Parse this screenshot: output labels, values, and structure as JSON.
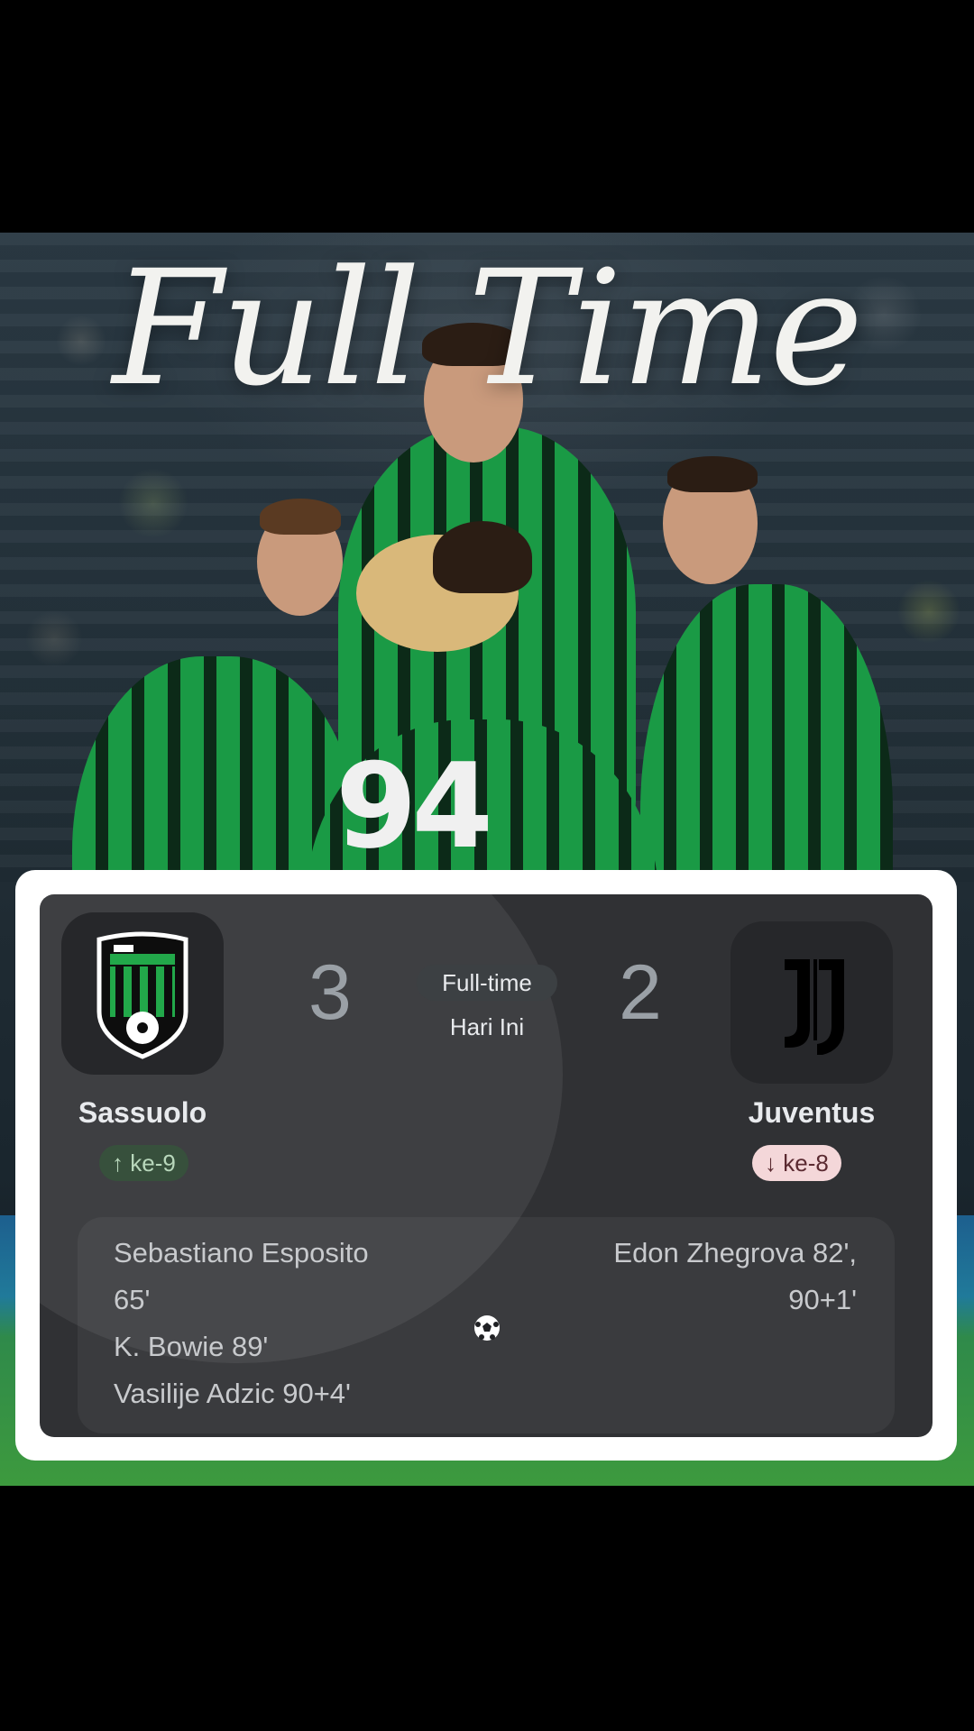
{
  "overlay_title": "Full Time",
  "jersey_number": "94",
  "match": {
    "status": "Full-time",
    "date_label": "Hari Ini",
    "home": {
      "name": "Sassuolo",
      "score": "3",
      "rank_label": "ke-9",
      "rank_arrow": "↑",
      "scorers": [
        "Sebastiano Esposito",
        "65'",
        "K. Bowie 89'",
        "Vasilije Adzic 90+4'"
      ]
    },
    "away": {
      "name": "Juventus",
      "score": "2",
      "rank_label": "ke-8",
      "rank_arrow": "↓",
      "scorers": [
        "Edon Zhegrova 82',",
        "90+1'"
      ]
    }
  },
  "icons": {
    "home_logo": "sassuolo-crest-icon",
    "away_logo": "juventus-logo-icon",
    "goal": "soccer-ball-icon"
  },
  "colors": {
    "card_bg": "#303134",
    "home_rank_bg": "#37503c",
    "away_rank_bg": "#f4d7d9",
    "sassuolo_green": "#1a9a45"
  }
}
